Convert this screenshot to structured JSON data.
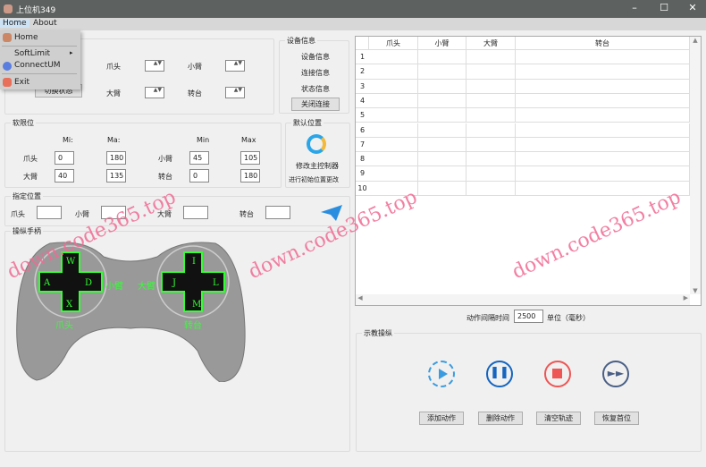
{
  "window": {
    "title": "上位机349",
    "minimize": "–",
    "maximize": "☐",
    "close": "✕"
  },
  "menu": {
    "home": "Home",
    "about": "About"
  },
  "dropdown": {
    "items": [
      {
        "label": "Home",
        "icon": "home-icon"
      },
      {
        "label": "SoftLimit",
        "icon": "submenu-arrow"
      },
      {
        "label": "ConnectUM",
        "icon": "link-icon"
      },
      {
        "label": "Exit",
        "icon": "exit-icon"
      }
    ],
    "arrow": "▸"
  },
  "control": {
    "switch_button": "切换状态",
    "claw": "爪头",
    "forearm": "小臂",
    "upperarm": "大臂",
    "turntable": "转台",
    "spin_glyph": "▲▼"
  },
  "device": {
    "title": "设备信息",
    "info": "设备信息",
    "connect": "连接信息",
    "status": "状态信息",
    "close_button": "关闭连接"
  },
  "softlimit": {
    "title": "软限位",
    "min1": "Mi:",
    "max1": "Ma:",
    "min2": "Min",
    "max2": "Max",
    "rows": [
      {
        "l1": "爪头",
        "min1": "0",
        "max1": "180",
        "l2": "小臂",
        "min2": "45",
        "max2": "105"
      },
      {
        "l1": "大臂",
        "min1": "40",
        "max1": "135",
        "l2": "转台",
        "min2": "0",
        "max2": "180"
      }
    ]
  },
  "default_pos": {
    "title": "默认位置",
    "action": "修改主控制器",
    "sub": "进行初始位置更改"
  },
  "target": {
    "title": "指定位置",
    "claw": "爪头",
    "forearm": "小臂",
    "upperarm": "大臂",
    "turntable": "转台"
  },
  "gamepad": {
    "title": "操纵手柄",
    "left_keys": [
      "W",
      "A",
      "D",
      "X"
    ],
    "right_keys": [
      "I",
      "J",
      "L",
      "M"
    ],
    "label_claw": "爪头",
    "label_forearm": "小臂",
    "label_upperarm": "大臂",
    "label_turntable": "转台"
  },
  "table": {
    "columns": [
      "爪头",
      "小臂",
      "大臂",
      "转台"
    ],
    "rows": [
      "1",
      "2",
      "3",
      "4",
      "5",
      "6",
      "7",
      "8",
      "9",
      "10"
    ]
  },
  "interval": {
    "label": "动作间隔时间",
    "value": "2500",
    "unit": "单位（毫秒）"
  },
  "teach": {
    "title": "示教操纵",
    "buttons": [
      "添加动作",
      "删除动作",
      "清空轨迹",
      "恢复首位"
    ]
  },
  "watermark": "down.code365.top",
  "colors": {
    "accent_green": "#33ff33",
    "play": "#3a9be0",
    "pause": "#1565c0",
    "stop": "#ee5555",
    "ff": "#4a5f85"
  }
}
